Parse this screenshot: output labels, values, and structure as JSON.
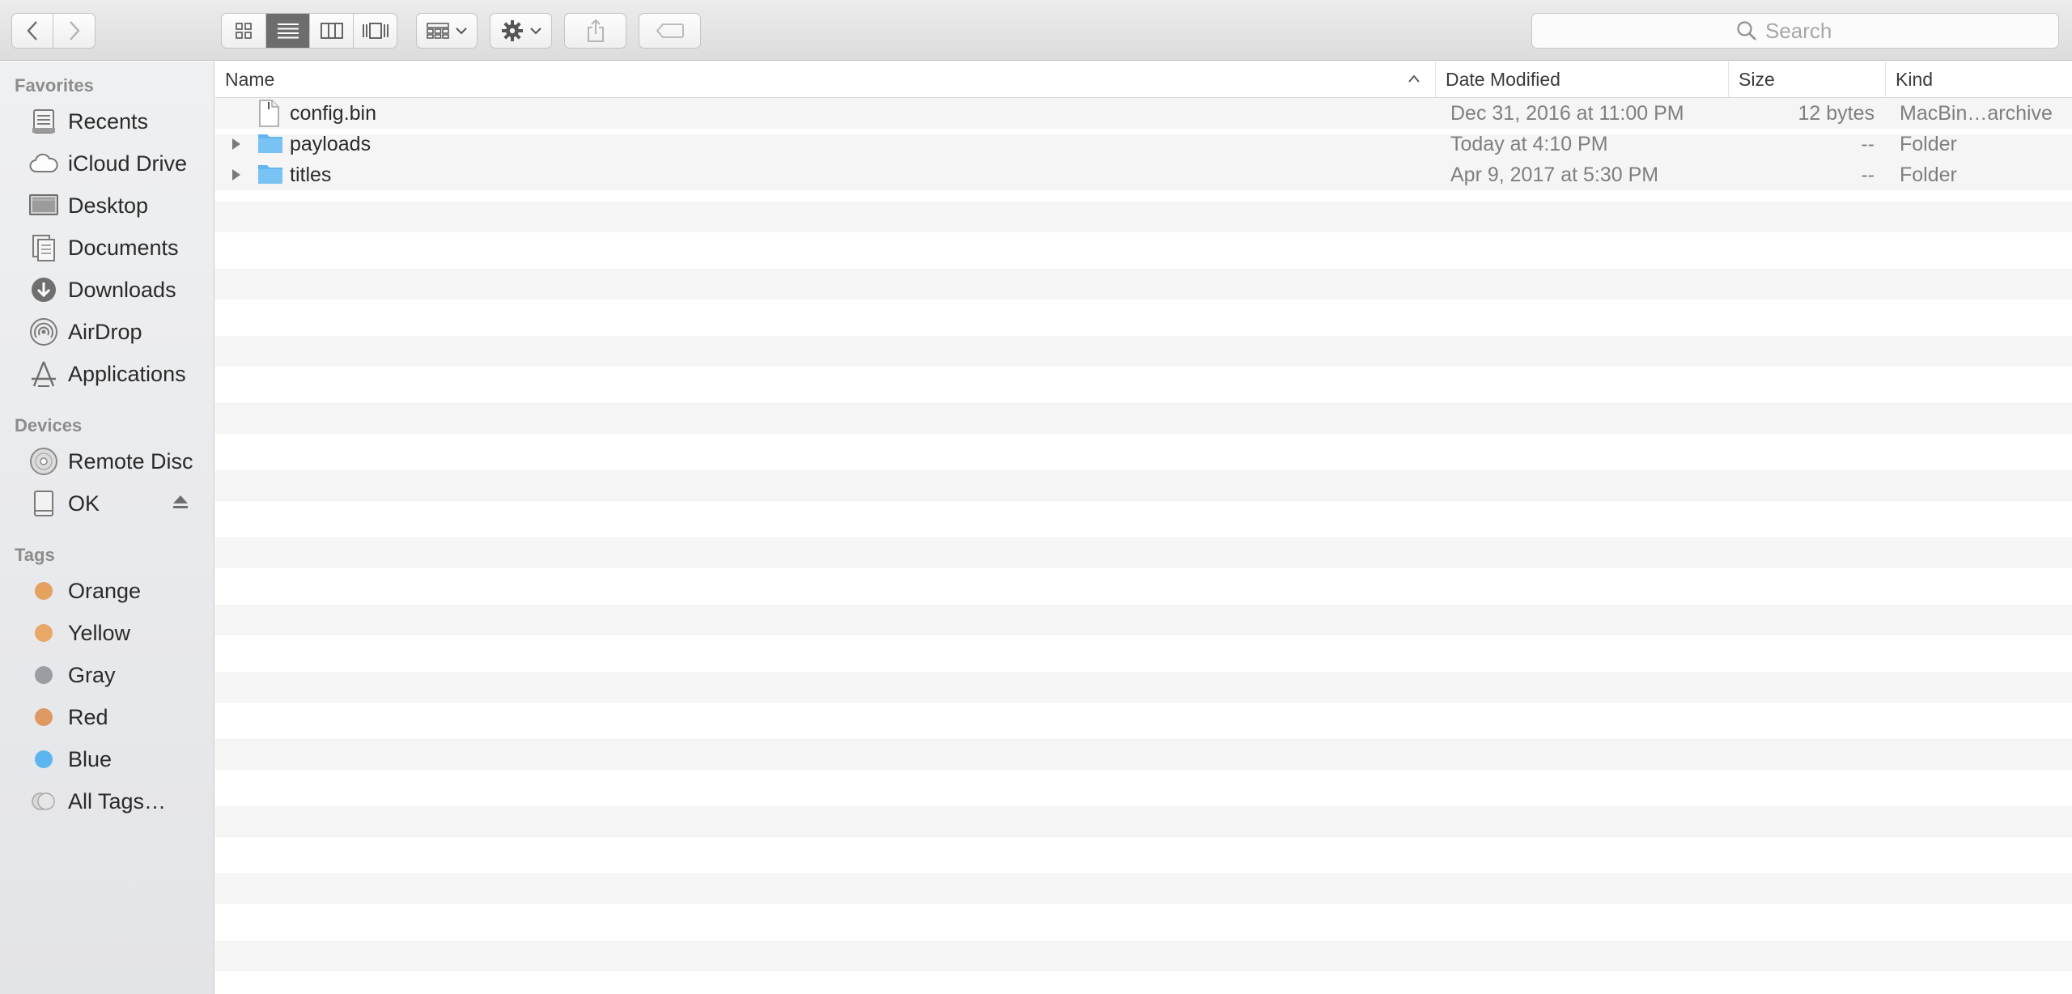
{
  "toolbar": {
    "nav": {
      "back_icon": "chevron-left-icon",
      "forward_icon": "chevron-right-icon"
    },
    "view_modes": [
      "icon-view-icon",
      "list-view-icon",
      "column-view-icon",
      "coverflow-view-icon"
    ],
    "active_view": "list",
    "search_placeholder": "Search"
  },
  "sidebar": {
    "favorites_heading": "Favorites",
    "favorites": [
      {
        "label": "Recents",
        "icon": "recents-icon"
      },
      {
        "label": "iCloud Drive",
        "icon": "cloud-icon"
      },
      {
        "label": "Desktop",
        "icon": "desktop-icon"
      },
      {
        "label": "Documents",
        "icon": "documents-icon"
      },
      {
        "label": "Downloads",
        "icon": "downloads-icon"
      },
      {
        "label": "AirDrop",
        "icon": "airdrop-icon"
      },
      {
        "label": "Applications",
        "icon": "applications-icon"
      }
    ],
    "devices_heading": "Devices",
    "devices": [
      {
        "label": "Remote Disc",
        "icon": "disc-icon"
      },
      {
        "label": "OK",
        "icon": "drive-icon"
      }
    ],
    "tags_heading": "Tags",
    "tags": [
      {
        "label": "Orange",
        "color": "#e5a15f"
      },
      {
        "label": "Yellow",
        "color": "#e9a868"
      },
      {
        "label": "Gray",
        "color": "#9a9ea3"
      },
      {
        "label": "Red",
        "color": "#df9a64"
      },
      {
        "label": "Blue",
        "color": "#5cb5ef"
      },
      {
        "label": "All Tags…",
        "color": "#c8c8c8"
      }
    ]
  },
  "columns": {
    "name": "Name",
    "date": "Date Modified",
    "size": "Size",
    "kind": "Kind"
  },
  "files": [
    {
      "name": "config.bin",
      "date": "Dec 31, 2016 at 11:00 PM",
      "size": "12 bytes",
      "kind": "MacBin…archive",
      "type": "file"
    },
    {
      "name": "payloads",
      "date": "Today at 4:10 PM",
      "size": "--",
      "kind": "Folder",
      "type": "folder"
    },
    {
      "name": "titles",
      "date": "Apr 9, 2017 at 5:30 PM",
      "size": "--",
      "kind": "Folder",
      "type": "folder"
    }
  ],
  "colors": {
    "folder": "#63b6ee",
    "active_segment": "#6d6d6d"
  }
}
